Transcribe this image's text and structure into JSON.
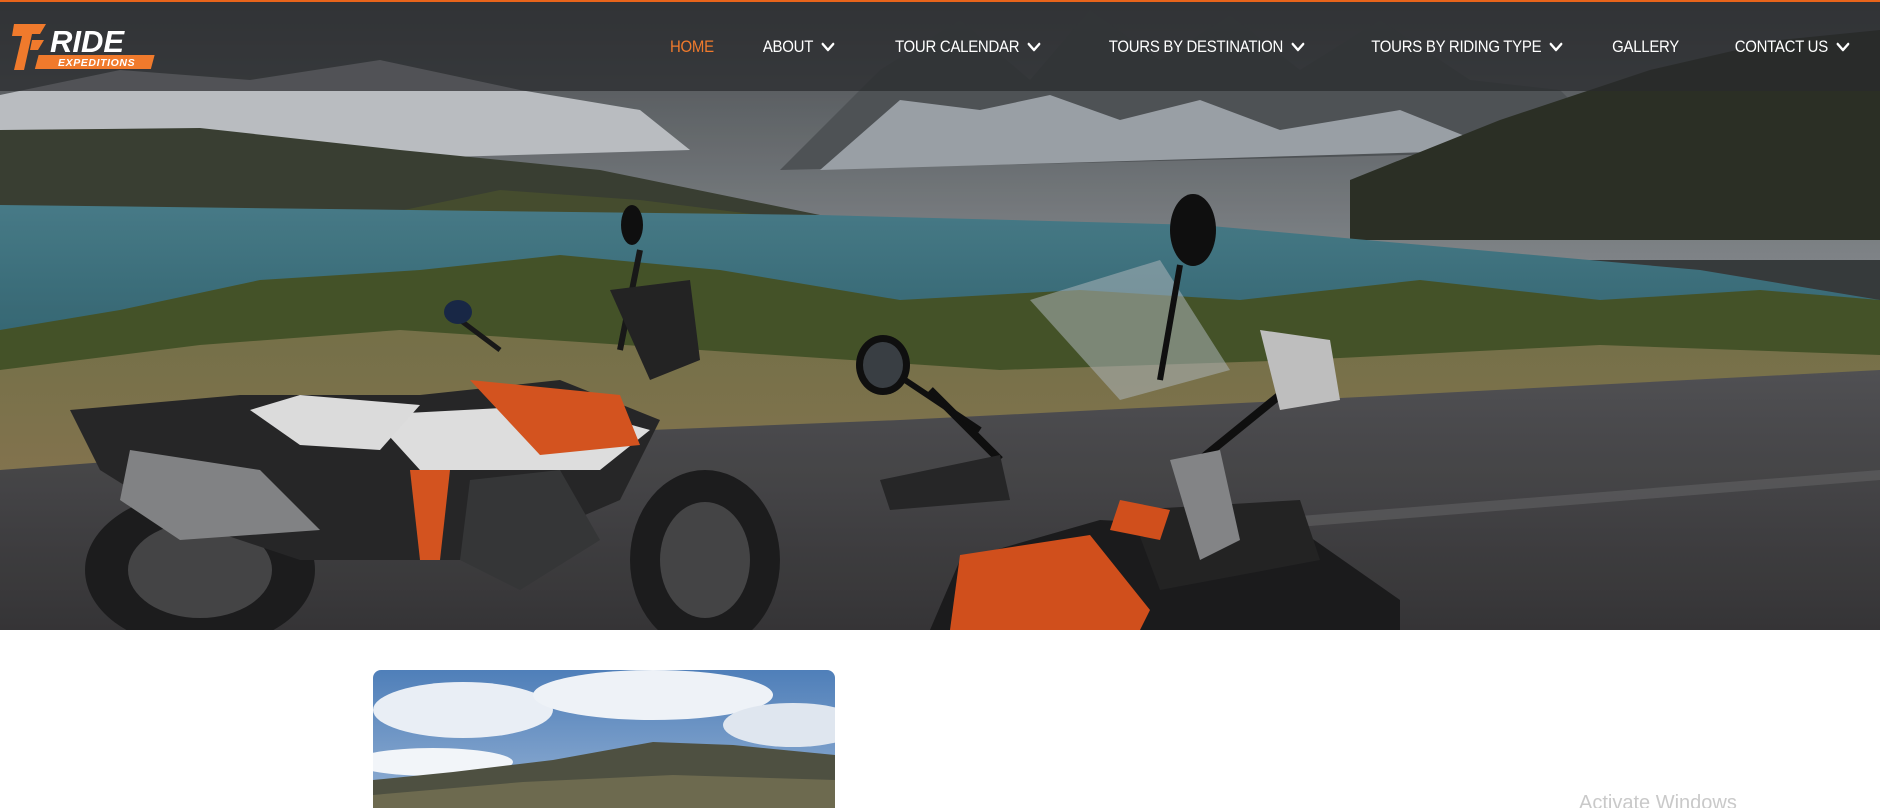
{
  "logo": {
    "text": "RIDE",
    "subtext": "EXPEDITIONS",
    "accent": "#f07a2c"
  },
  "nav": {
    "items": [
      {
        "label": "HOME",
        "active": true,
        "dropdown": false
      },
      {
        "label": "ABOUT",
        "active": false,
        "dropdown": true
      },
      {
        "label": "TOUR CALENDAR",
        "active": false,
        "dropdown": true
      },
      {
        "label": "TOURS BY DESTINATION",
        "active": false,
        "dropdown": true
      },
      {
        "label": "TOURS BY RIDING TYPE",
        "active": false,
        "dropdown": true
      },
      {
        "label": "GALLERY",
        "active": false,
        "dropdown": false
      },
      {
        "label": "CONTACT US",
        "active": false,
        "dropdown": true
      }
    ],
    "dropdown_icon": "chevron-down-icon"
  },
  "watermark": {
    "text": "Activate Windows"
  },
  "colors": {
    "accent": "#f07a2c",
    "header_bg": "#2b2d2f",
    "text": "#ffffff"
  }
}
